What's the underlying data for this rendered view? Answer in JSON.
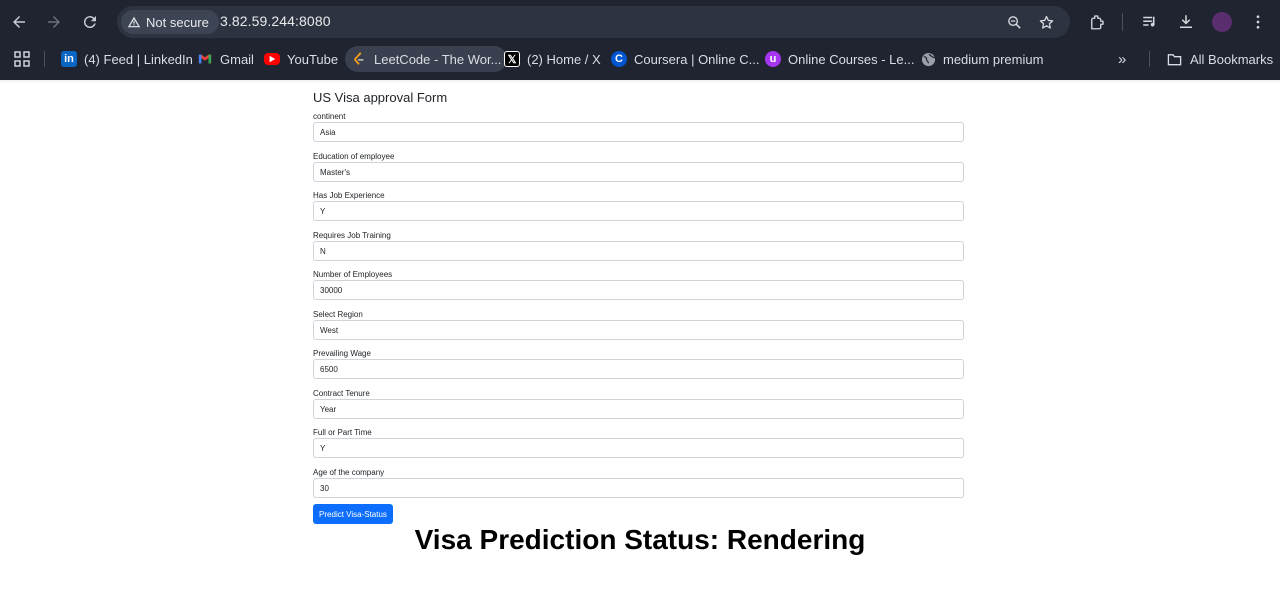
{
  "browser": {
    "security_label": "Not secure",
    "url": "3.82.59.244:8080"
  },
  "bookmarks": {
    "items": [
      {
        "label": "(4) Feed | LinkedIn",
        "icon": "linkedin-icon",
        "color": "#0a66c2"
      },
      {
        "label": "Gmail",
        "icon": "gmail-icon",
        "color": "#ea4335"
      },
      {
        "label": "YouTube",
        "icon": "youtube-icon",
        "color": "#ff0000"
      },
      {
        "label": "LeetCode - The Wor...",
        "icon": "leetcode-icon",
        "color": "#ffa116"
      },
      {
        "label": "(2) Home / X",
        "icon": "x-icon",
        "color": "#000000"
      },
      {
        "label": "Coursera | Online C...",
        "icon": "coursera-icon",
        "color": "#0056d2"
      },
      {
        "label": "Online Courses - Le...",
        "icon": "udemy-icon",
        "color": "#a435f0"
      },
      {
        "label": "medium premium",
        "icon": "globe-icon",
        "color": "#9aa0a6"
      }
    ],
    "all_bookmarks_label": "All Bookmarks"
  },
  "form": {
    "title": "US Visa approval Form",
    "fields": [
      {
        "label": "continent",
        "value": "Asia"
      },
      {
        "label": "Education of employee",
        "value": "Master's"
      },
      {
        "label": "Has Job Experience",
        "value": "Y"
      },
      {
        "label": "Requires Job Training",
        "value": "N"
      },
      {
        "label": "Number of Employees",
        "value": "30000"
      },
      {
        "label": "Select Region",
        "value": "West"
      },
      {
        "label": "Prevailing Wage",
        "value": "6500"
      },
      {
        "label": "Contract Tenure",
        "value": "Year"
      },
      {
        "label": "Full or Part Time",
        "value": "Y"
      },
      {
        "label": "Age of the company",
        "value": "30"
      }
    ],
    "submit_label": "Predict Visa-Status",
    "accent_color": "#0d6efd"
  },
  "result": {
    "status_text": "Visa Prediction Status: Rendering"
  }
}
